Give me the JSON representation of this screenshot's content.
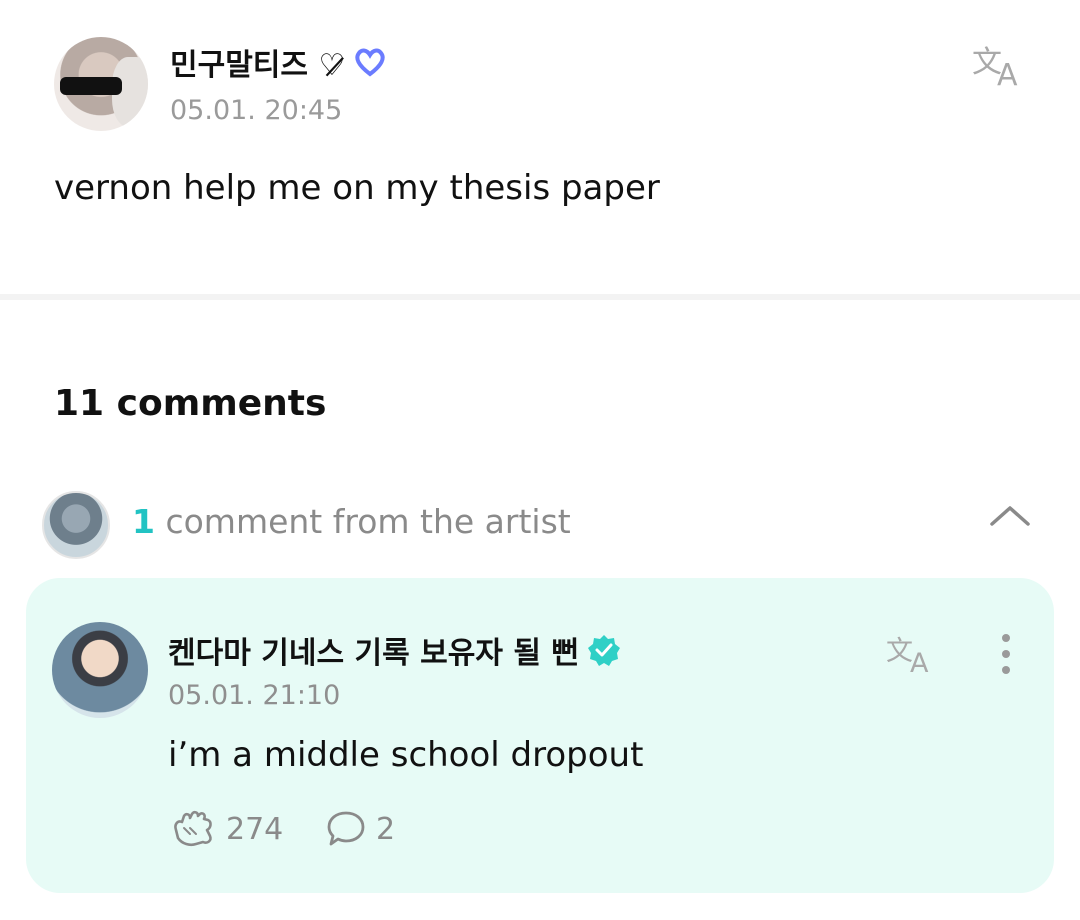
{
  "post": {
    "author": "민구말티즈 ♡̷",
    "time": "05.01. 20:45",
    "text": "vernon help me on my thesis paper",
    "badge_color": "#6b7cff",
    "translate_icon": "translate-icon"
  },
  "comments": {
    "count_label": "11 comments",
    "artist_summary": {
      "count": "1",
      "label": "comment from the artist",
      "chevron_icon": "chevron-up-icon"
    }
  },
  "artist_comment": {
    "author": "켄다마 기네스 기록 보유자 될 뻔",
    "time": "05.01. 21:10",
    "text": "i’m a middle school dropout",
    "likes": "274",
    "replies": "2",
    "verified_color": "#2fd0c6",
    "card_color": "#e7fbf6"
  }
}
